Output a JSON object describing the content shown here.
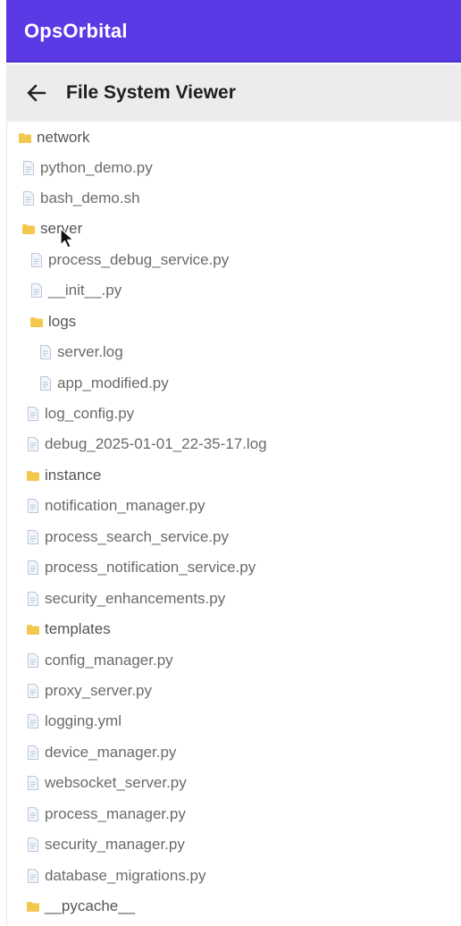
{
  "app_bar": {
    "title": "OpsOrbital"
  },
  "header": {
    "title": "File System Viewer"
  },
  "colors": {
    "accent": "#5b3ae6",
    "folder": "#f2c94c",
    "file": "#b9c7dd"
  },
  "tree": [
    {
      "name": "network",
      "kind": "folder"
    },
    {
      "name": "python_demo.py",
      "kind": "file"
    },
    {
      "name": "bash_demo.sh",
      "kind": "file"
    },
    {
      "name": "server",
      "kind": "folder"
    },
    {
      "name": "process_debug_service.py",
      "kind": "file"
    },
    {
      "name": "__init__.py",
      "kind": "file"
    },
    {
      "name": "logs",
      "kind": "folder"
    },
    {
      "name": "server.log",
      "kind": "file"
    },
    {
      "name": "app_modified.py",
      "kind": "file"
    },
    {
      "name": "log_config.py",
      "kind": "file"
    },
    {
      "name": "debug_2025-01-01_22-35-17.log",
      "kind": "file"
    },
    {
      "name": "instance",
      "kind": "folder"
    },
    {
      "name": "notification_manager.py",
      "kind": "file"
    },
    {
      "name": "process_search_service.py",
      "kind": "file"
    },
    {
      "name": "process_notification_service.py",
      "kind": "file"
    },
    {
      "name": "security_enhancements.py",
      "kind": "file"
    },
    {
      "name": "templates",
      "kind": "folder"
    },
    {
      "name": "config_manager.py",
      "kind": "file"
    },
    {
      "name": "proxy_server.py",
      "kind": "file"
    },
    {
      "name": "logging.yml",
      "kind": "file"
    },
    {
      "name": "device_manager.py",
      "kind": "file"
    },
    {
      "name": "websocket_server.py",
      "kind": "file"
    },
    {
      "name": "process_manager.py",
      "kind": "file"
    },
    {
      "name": "security_manager.py",
      "kind": "file"
    },
    {
      "name": "database_migrations.py",
      "kind": "file"
    },
    {
      "name": "__pycache__",
      "kind": "folder"
    }
  ]
}
